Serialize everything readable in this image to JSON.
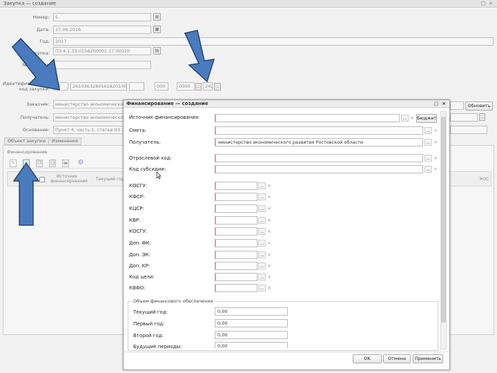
{
  "outer": {
    "title": "Закупка — создание",
    "labels": {
      "number": "Номер:",
      "date": "Дата:",
      "year": "Год:",
      "purchase_no": "Закупка:",
      "order_no": "№ позиции:",
      "ikz": "Идентификационный код закупки:",
      "customer": "Заказчик:",
      "recipient": "Получатель:",
      "basis": "Основание:"
    },
    "values": {
      "number": "5",
      "date": "17.06.2016",
      "year": "2017",
      "purchase_no": "П3.4.1.33.0156200001.17.00020",
      "ikz_year": "17",
      "ikz_code": "2610363280561820100",
      "ikz_p1": "",
      "ikz_p2": "000",
      "ikz_p3": "0000",
      "ikz_p4": "242",
      "customer": "министерство экономического ра",
      "recipient": "министерство экономического р",
      "basis": "Пункт 4, часть 1, статьи 93 Закон"
    },
    "refresh_button": "Обновить",
    "tabs": [
      "Объект закупки",
      "Изменения"
    ],
    "section_label": "Финансирование",
    "table_headers": [
      "Источник финансирования",
      "Текущий год"
    ],
    "right_header": "КОС"
  },
  "dialog": {
    "title": "Финансирование — создание",
    "fields": [
      {
        "label": "Источник финансирования:",
        "value": ""
      },
      {
        "label": "Смета:",
        "value": ""
      },
      {
        "label": "Получатель:",
        "value": "министерство экономического развития Ростовской области"
      },
      {
        "label": "Отраслевой код:",
        "value": ""
      },
      {
        "label": "Код субсидии:",
        "value": ""
      },
      {
        "label": "КОСГУ:",
        "value": ""
      },
      {
        "label": "КФСР:",
        "value": ""
      },
      {
        "label": "КЦСР:",
        "value": ""
      },
      {
        "label": "КВР:",
        "value": ""
      },
      {
        "label": "КОСГУ:",
        "value": ""
      },
      {
        "label": "Доп. ФК:",
        "value": ""
      },
      {
        "label": "Доп. ЭК:",
        "value": ""
      },
      {
        "label": "Доп. КР:",
        "value": ""
      },
      {
        "label": "Код цели:",
        "value": ""
      },
      {
        "label": "КВФО:",
        "value": ""
      }
    ],
    "source_button": "Бюджет",
    "fieldset_legend": "Объем финансового обеспечения",
    "amounts": [
      {
        "label": "Текущий год:",
        "value": "0,00"
      },
      {
        "label": "Первый год:",
        "value": "0,00"
      },
      {
        "label": "Второй год:",
        "value": "0,00"
      },
      {
        "label": "Будущие периоды:",
        "value": "0,00"
      }
    ],
    "buttons": {
      "ok": "OK",
      "cancel": "Отмена",
      "apply": "Применить"
    },
    "dropdown_glyph": "…",
    "clear_glyph": "×"
  },
  "annotations": {
    "arrow_color": "#4a7bbf",
    "arrow_stroke": "#22446f"
  }
}
